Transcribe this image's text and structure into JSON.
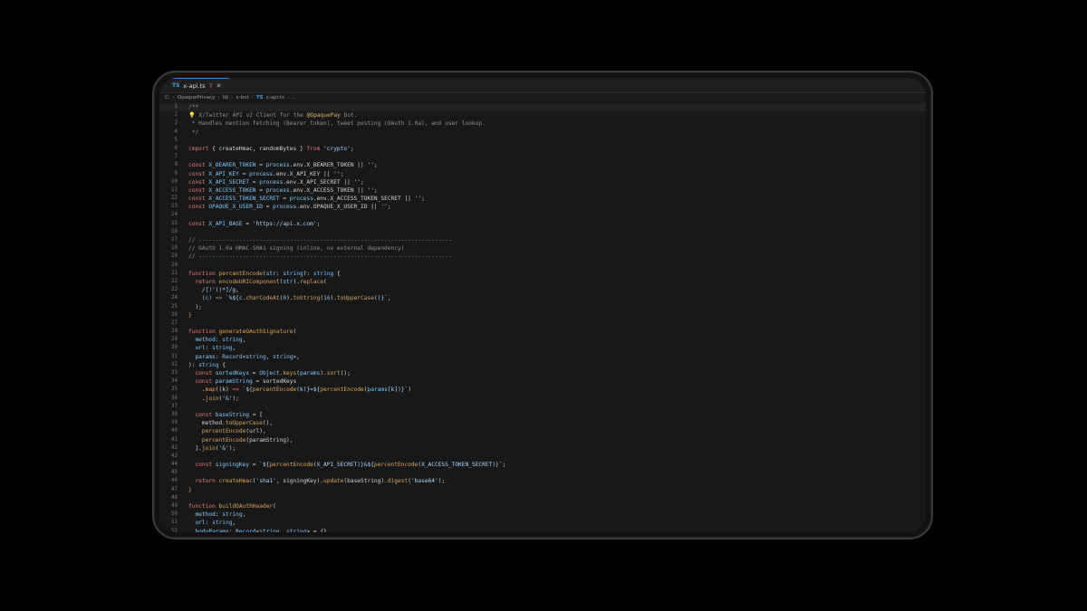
{
  "tab": {
    "icon": "TS",
    "filename": "x-api.ts",
    "problems": "7",
    "close": "✕"
  },
  "breadcrumb": [
    "C:",
    "OpaquePrivacy",
    "lib",
    "x-bot",
    "TS",
    "x-api.ts",
    "..."
  ],
  "code_lines": [
    [
      [
        "/**",
        "c-com"
      ]
    ],
    [
      [
        "💡 X/Twitter API v2 Client for the ",
        "c-com"
      ],
      [
        "@OpaquePay",
        "c-at"
      ],
      [
        " bot.",
        "c-com"
      ]
    ],
    [
      [
        " * Handles mention fetching (Bearer token), tweet posting (OAuth 1.0a), and user lookup.",
        "c-com"
      ]
    ],
    [
      [
        " */",
        "c-com"
      ]
    ],
    [],
    [
      [
        "import",
        "c-kw"
      ],
      [
        " { createHmac, randomBytes } ",
        "c-p"
      ],
      [
        "from",
        "c-kw"
      ],
      [
        " 'crypto'",
        "c-str"
      ],
      [
        ";",
        "c-p"
      ]
    ],
    [],
    [
      [
        "const",
        "c-kw"
      ],
      [
        " X_BEARER_TOKEN ",
        "c-var"
      ],
      [
        "= ",
        "c-p"
      ],
      [
        "process",
        "c-var"
      ],
      [
        ".env.X_BEARER_TOKEN || ",
        "c-p"
      ],
      [
        "''",
        "c-str"
      ],
      [
        ";",
        "c-p"
      ]
    ],
    [
      [
        "const",
        "c-kw"
      ],
      [
        " X_API_KEY ",
        "c-var"
      ],
      [
        "= ",
        "c-p"
      ],
      [
        "process",
        "c-var"
      ],
      [
        ".env.X_API_KEY || ",
        "c-p"
      ],
      [
        "''",
        "c-str"
      ],
      [
        ";",
        "c-p"
      ]
    ],
    [
      [
        "const",
        "c-kw"
      ],
      [
        " X_API_SECRET ",
        "c-var"
      ],
      [
        "= ",
        "c-p"
      ],
      [
        "process",
        "c-var"
      ],
      [
        ".env.X_API_SECRET || ",
        "c-p"
      ],
      [
        "''",
        "c-str"
      ],
      [
        ";",
        "c-p"
      ]
    ],
    [
      [
        "const",
        "c-kw"
      ],
      [
        " X_ACCESS_TOKEN ",
        "c-var"
      ],
      [
        "= ",
        "c-p"
      ],
      [
        "process",
        "c-var"
      ],
      [
        ".env.X_ACCESS_TOKEN || ",
        "c-p"
      ],
      [
        "''",
        "c-str"
      ],
      [
        ";",
        "c-p"
      ]
    ],
    [
      [
        "const",
        "c-kw"
      ],
      [
        " X_ACCESS_TOKEN_SECRET ",
        "c-var"
      ],
      [
        "= ",
        "c-p"
      ],
      [
        "process",
        "c-var"
      ],
      [
        ".env.X_ACCESS_TOKEN_SECRET || ",
        "c-p"
      ],
      [
        "''",
        "c-str"
      ],
      [
        ";",
        "c-p"
      ]
    ],
    [
      [
        "const",
        "c-kw"
      ],
      [
        " OPAQUE_X_USER_ID ",
        "c-var"
      ],
      [
        "= ",
        "c-p"
      ],
      [
        "process",
        "c-var"
      ],
      [
        ".env.OPAQUE_X_USER_ID || ",
        "c-p"
      ],
      [
        "''",
        "c-str"
      ],
      [
        ";",
        "c-p"
      ]
    ],
    [],
    [
      [
        "const",
        "c-kw"
      ],
      [
        " X_API_BASE ",
        "c-var"
      ],
      [
        "= ",
        "c-p"
      ],
      [
        "'https://api.x.com'",
        "c-str"
      ],
      [
        ";",
        "c-p"
      ]
    ],
    [],
    [
      [
        "// ---------------------------------------------------------------------------",
        "c-com"
      ]
    ],
    [
      [
        "// OAuth 1.0a HMAC-SHA1 signing (inline, no external dependency)",
        "c-com"
      ]
    ],
    [
      [
        "// ---------------------------------------------------------------------------",
        "c-com"
      ]
    ],
    [],
    [
      [
        "function",
        "c-kw"
      ],
      [
        " percentEncode",
        "c-fn"
      ],
      [
        "(",
        "c-p"
      ],
      [
        "str",
        "c-var"
      ],
      [
        ": ",
        "c-p"
      ],
      [
        "string",
        "c-type"
      ],
      [
        "): ",
        "c-p"
      ],
      [
        "string",
        "c-type"
      ],
      [
        " {",
        "c-p"
      ]
    ],
    [
      [
        "  return",
        "c-kw"
      ],
      [
        " encodeURIComponent",
        "c-fn"
      ],
      [
        "(",
        "c-p"
      ],
      [
        "str",
        "c-var"
      ],
      [
        ").",
        "c-p"
      ],
      [
        "replace",
        "c-fn"
      ],
      [
        "(",
        "c-p"
      ]
    ],
    [
      [
        "    /[!'()*]/g",
        "c-str"
      ],
      [
        ",",
        "c-p"
      ]
    ],
    [
      [
        "    (c) ",
        "c-var"
      ],
      [
        "=> ",
        "c-kw"
      ],
      [
        "`%${c.",
        "c-str"
      ],
      [
        "charCodeAt",
        "c-fn"
      ],
      [
        "(",
        "c-p"
      ],
      [
        "0",
        "c-num"
      ],
      [
        ").",
        "c-p"
      ],
      [
        "toString",
        "c-fn"
      ],
      [
        "(",
        "c-p"
      ],
      [
        "16",
        "c-num"
      ],
      [
        ").",
        "c-p"
      ],
      [
        "toUpperCase",
        "c-fn"
      ],
      [
        "()}`",
        "c-str"
      ],
      [
        ",",
        "c-p"
      ]
    ],
    [
      [
        "  );",
        "c-p"
      ]
    ],
    [
      [
        "}",
        "c-fn"
      ]
    ],
    [],
    [
      [
        "function",
        "c-kw"
      ],
      [
        " generateOAuthSignature",
        "c-fn"
      ],
      [
        "(",
        "c-p"
      ]
    ],
    [
      [
        "  method",
        "c-var"
      ],
      [
        ": ",
        "c-p"
      ],
      [
        "string",
        "c-type"
      ],
      [
        ",",
        "c-p"
      ]
    ],
    [
      [
        "  url",
        "c-var"
      ],
      [
        ": ",
        "c-p"
      ],
      [
        "string",
        "c-type"
      ],
      [
        ",",
        "c-p"
      ]
    ],
    [
      [
        "  params",
        "c-var"
      ],
      [
        ": ",
        "c-p"
      ],
      [
        "Record",
        "c-type"
      ],
      [
        "<",
        "c-p"
      ],
      [
        "string",
        "c-type"
      ],
      [
        ", ",
        "c-p"
      ],
      [
        "string",
        "c-type"
      ],
      [
        ">,",
        "c-p"
      ]
    ],
    [
      [
        "): ",
        "c-p"
      ],
      [
        "string",
        "c-type"
      ],
      [
        " {",
        "c-p"
      ]
    ],
    [
      [
        "  const",
        "c-kw"
      ],
      [
        " sortedKeys ",
        "c-var"
      ],
      [
        "= ",
        "c-p"
      ],
      [
        "Object",
        "c-type"
      ],
      [
        ".",
        "c-p"
      ],
      [
        "keys",
        "c-fn"
      ],
      [
        "(",
        "c-p"
      ],
      [
        "params",
        "c-var"
      ],
      [
        ").",
        "c-p"
      ],
      [
        "sort",
        "c-fn"
      ],
      [
        "();",
        "c-p"
      ]
    ],
    [
      [
        "  const",
        "c-kw"
      ],
      [
        " paramString ",
        "c-var"
      ],
      [
        "= sortedKeys",
        "c-p"
      ]
    ],
    [
      [
        "    .",
        "c-p"
      ],
      [
        "map",
        "c-fn"
      ],
      [
        "((k) ",
        "c-p"
      ],
      [
        "=> ",
        "c-kw"
      ],
      [
        "`${",
        "c-str"
      ],
      [
        "percentEncode",
        "c-fn"
      ],
      [
        "(k)}=${",
        "c-str"
      ],
      [
        "percentEncode",
        "c-fn"
      ],
      [
        "(",
        "c-p"
      ],
      [
        "params",
        "c-var"
      ],
      [
        "[k])}`",
        "c-str"
      ],
      [
        ")",
        "c-p"
      ]
    ],
    [
      [
        "    .",
        "c-p"
      ],
      [
        "join",
        "c-fn"
      ],
      [
        "(",
        "c-p"
      ],
      [
        "'&'",
        "c-str"
      ],
      [
        ");",
        "c-p"
      ]
    ],
    [],
    [
      [
        "  const",
        "c-kw"
      ],
      [
        " baseString ",
        "c-var"
      ],
      [
        "= [",
        "c-p"
      ]
    ],
    [
      [
        "    method.",
        "c-p"
      ],
      [
        "toUpperCase",
        "c-fn"
      ],
      [
        "(),",
        "c-p"
      ]
    ],
    [
      [
        "    percentEncode",
        "c-fn"
      ],
      [
        "(url),",
        "c-p"
      ]
    ],
    [
      [
        "    percentEncode",
        "c-fn"
      ],
      [
        "(paramString),",
        "c-p"
      ]
    ],
    [
      [
        "  ].",
        "c-p"
      ],
      [
        "join",
        "c-fn"
      ],
      [
        "(",
        "c-p"
      ],
      [
        "'&'",
        "c-str"
      ],
      [
        ");",
        "c-p"
      ]
    ],
    [],
    [
      [
        "  const",
        "c-kw"
      ],
      [
        " signingKey ",
        "c-var"
      ],
      [
        "= ",
        "c-p"
      ],
      [
        "`${",
        "c-str"
      ],
      [
        "percentEncode",
        "c-fn"
      ],
      [
        "(X_API_SECRET)}&${",
        "c-str"
      ],
      [
        "percentEncode",
        "c-fn"
      ],
      [
        "(X_ACCESS_TOKEN_SECRET)}`",
        "c-str"
      ],
      [
        ";",
        "c-p"
      ]
    ],
    [],
    [
      [
        "  return",
        "c-kw"
      ],
      [
        " createHmac",
        "c-fn"
      ],
      [
        "(",
        "c-p"
      ],
      [
        "'sha1'",
        "c-str"
      ],
      [
        ", signingKey).",
        "c-p"
      ],
      [
        "update",
        "c-fn"
      ],
      [
        "(baseString).",
        "c-p"
      ],
      [
        "digest",
        "c-fn"
      ],
      [
        "(",
        "c-p"
      ],
      [
        "'base64'",
        "c-str"
      ],
      [
        ");",
        "c-p"
      ]
    ],
    [
      [
        "}",
        "c-fn"
      ]
    ],
    [],
    [
      [
        "function",
        "c-kw"
      ],
      [
        " buildOAuthHeader",
        "c-fn"
      ],
      [
        "(",
        "c-p"
      ]
    ],
    [
      [
        "  method",
        "c-var"
      ],
      [
        ": ",
        "c-p"
      ],
      [
        "string",
        "c-type"
      ],
      [
        ",",
        "c-p"
      ]
    ],
    [
      [
        "  url",
        "c-var"
      ],
      [
        ": ",
        "c-p"
      ],
      [
        "string",
        "c-type"
      ],
      [
        ",",
        "c-p"
      ]
    ],
    [
      [
        "  bodyParams",
        "c-var"
      ],
      [
        ": ",
        "c-p"
      ],
      [
        "Record",
        "c-type"
      ],
      [
        "<",
        "c-p"
      ],
      [
        "string",
        "c-type"
      ],
      [
        ", ",
        "c-p"
      ],
      [
        "string",
        "c-type"
      ],
      [
        "> = {},",
        "c-p"
      ]
    ]
  ],
  "current_line": 1
}
